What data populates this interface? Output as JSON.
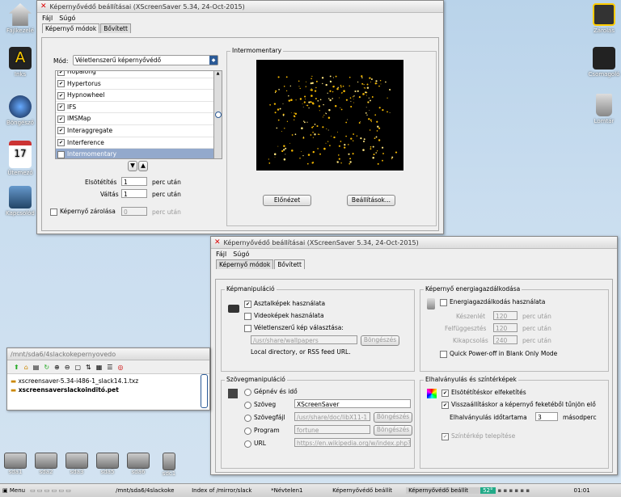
{
  "desktop_icons_left": [
    "Fájlkezelé",
    "Inks",
    "Böngésző",
    "Ütemező",
    "Kapcsolód"
  ],
  "desktop_icons_right": [
    "Zárolás",
    "Csomagoló",
    "Lomtár"
  ],
  "drives": [
    "sda1",
    "sda2",
    "sda3",
    "sda5",
    "sda6",
    "sdc1"
  ],
  "win1": {
    "title": "Képernyővédő beállításai  (XScreenSaver 5.34, 24-Oct-2015)",
    "menu": [
      "Fájl",
      "Súgó"
    ],
    "tabs": [
      "Képernyő módok",
      "Bővített"
    ],
    "mode_label": "Mód:",
    "mode_value": "Véletlenszerű képernyővédő",
    "list": [
      {
        "name": "Hopalong",
        "checked": true
      },
      {
        "name": "Hypertorus",
        "checked": true
      },
      {
        "name": "Hypnowheel",
        "checked": true
      },
      {
        "name": "IFS",
        "checked": true
      },
      {
        "name": "IMSMap",
        "checked": true
      },
      {
        "name": "Interaggregate",
        "checked": true
      },
      {
        "name": "Interference",
        "checked": true
      },
      {
        "name": "Intermomentary",
        "checked": true
      }
    ],
    "blank_label": "Elsötétítés",
    "blank_value": "1",
    "cycle_label": "Váltás",
    "cycle_value": "1",
    "unit": "perc után",
    "lock_label": "Képernyő zárolása",
    "lock_value": "0",
    "preview_frame": "Intermomentary",
    "preview_button": "Előnézet",
    "settings_button": "Beállítások..."
  },
  "win2": {
    "title": "Képernyővédő beállításai  (XScreenSaver 5.34, 24-Oct-2015)",
    "menu": [
      "Fájl",
      "Súgó"
    ],
    "tabs": [
      "Képernyő módok",
      "Bővített"
    ],
    "img_frame": "Képmanipuláció",
    "img_opt1": "Asztalképek használata",
    "img_opt2": "Videoképek használata",
    "img_opt3": "Véletlenszerű kép választása:",
    "img_path": "/usr/share/wallpapers",
    "browse": "Böngészés",
    "img_note": "Local directory, or RSS feed URL.",
    "text_frame": "Szövegmanipuláció",
    "text_opts": [
      "Gépnév és idő",
      "Szöveg",
      "Szövegfájl",
      "Program",
      "URL"
    ],
    "text_value": "XScreenSaver",
    "textfile_value": "/usr/share/doc/libX11-1",
    "program_value": "fortune",
    "url_value": "https://en.wikipedia.org/w/index.php?",
    "power_frame": "Képernyő energiagazdálkodása",
    "power_opt": "Energiagazdálkodás használata",
    "standby_label": "Készenlét",
    "suspend_label": "Felfüggesztés",
    "off_label": "Kikapcsolás",
    "standby_value": "120",
    "suspend_value": "120",
    "off_value": "240",
    "unit": "perc után",
    "quick_power": "Quick Power-off in Blank Only Mode",
    "fade_frame": "Elhalványulás és színtérképek",
    "fade_opt1": "Elsötétítéskor elfeketítés",
    "fade_opt2": "Visszaállításkor a képernyő feketéből tűnjön elő",
    "fade_duration_label": "Elhalványulás időtartama",
    "fade_duration_value": "3",
    "fade_unit": "másodperc",
    "colormap": "Színtérkép telepítése"
  },
  "filewin": {
    "title": "/mnt/sda6/4slackokepernyovedo",
    "files": [
      "xscreensaver-5.34-i486-1_slack14.1.txz",
      "xscreensaverslackoinditó.pet"
    ]
  },
  "taskbar": {
    "menu": "Menu",
    "tasks": [
      "/mnt/sda6/4slackoke",
      "Index of /mirror/slack",
      "*Névtelen1",
      "Képernyővédő beállít",
      "Képernyővédő beállít"
    ],
    "temp": "52°",
    "clock": "01:01"
  }
}
